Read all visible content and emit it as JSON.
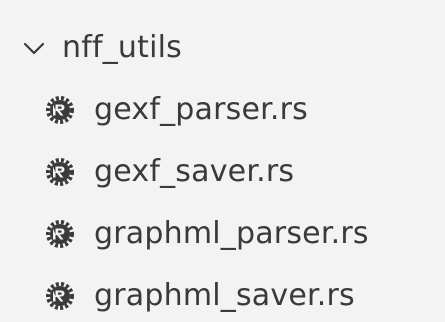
{
  "folder": {
    "name": "nff_utils",
    "icon": "chevron-down-icon"
  },
  "files": [
    {
      "name": "gexf_parser.rs",
      "icon": "rust-file-icon"
    },
    {
      "name": "gexf_saver.rs",
      "icon": "rust-file-icon"
    },
    {
      "name": "graphml_parser.rs",
      "icon": "rust-file-icon"
    },
    {
      "name": "graphml_saver.rs",
      "icon": "rust-file-icon"
    }
  ],
  "colors": {
    "background": "#f3f3f3",
    "text": "#3a3a3a",
    "icon": "#3a3a3a"
  }
}
